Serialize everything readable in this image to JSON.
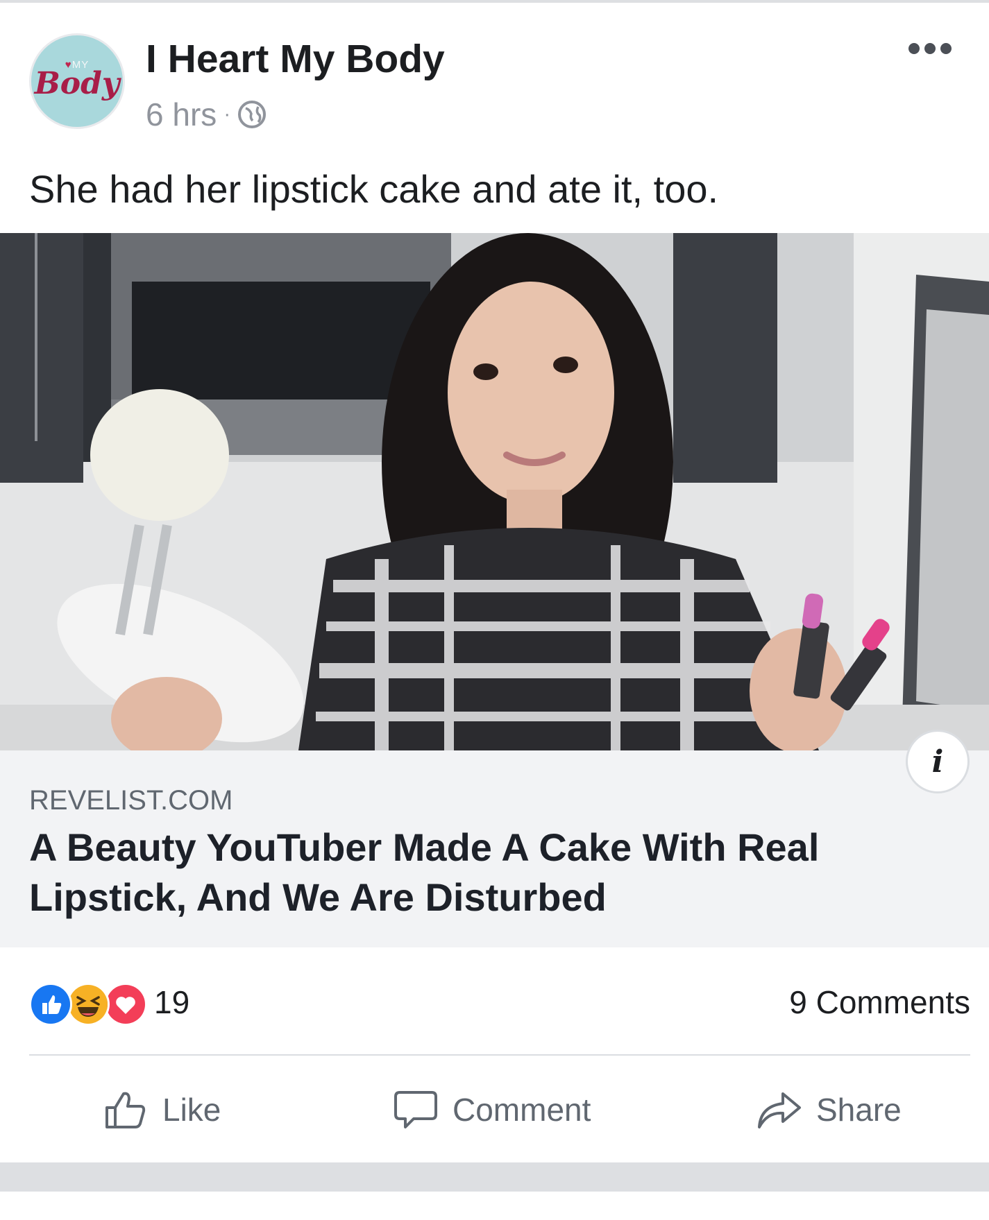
{
  "post": {
    "page_name": "I Heart My Body",
    "avatar": {
      "top_text": "MY",
      "word": "Body"
    },
    "time": "6 hrs",
    "separator": "·",
    "privacy_icon": "globe-icon",
    "more_icon": "more-dots-icon",
    "text": "She had her lipstick cake and ate it, too."
  },
  "photo": {
    "description_icon": "photo",
    "colors": {
      "background": "#5a5e63",
      "wall": "#d9dadb",
      "cabinet": "#3a3d42"
    }
  },
  "link": {
    "domain": "REVELIST.COM",
    "headline": "A Beauty YouTuber Made A Cake With Real Lipstick, And We Are Disturbed",
    "info_label": "i"
  },
  "engagement": {
    "reaction_icons": [
      "like-reaction-icon",
      "haha-reaction-icon",
      "love-reaction-icon"
    ],
    "reaction_count": "19",
    "comments_label": "9 Comments"
  },
  "actions": {
    "like_label": "Like",
    "comment_label": "Comment",
    "share_label": "Share"
  },
  "colors": {
    "text": "#1c1e21",
    "muted": "#90949c",
    "action_text": "#606770",
    "like_blue": "#1877f2",
    "love_red": "#f33e58",
    "haha_yellow": "#f7b125",
    "card_bg": "#f2f3f5"
  }
}
